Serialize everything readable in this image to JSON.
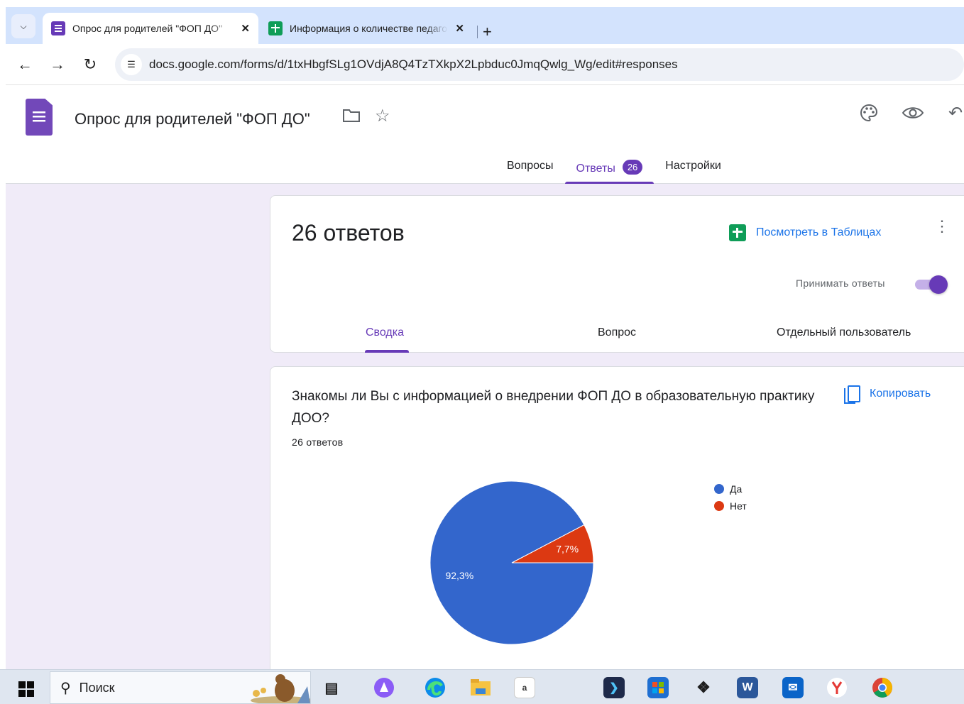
{
  "browser": {
    "tabs": [
      {
        "title": "Опрос для родителей \"ФОП ДО\"",
        "favicon": "forms-icon",
        "active": true
      },
      {
        "title": "Информация о количестве педагогов",
        "favicon": "sheets-icon",
        "active": false
      }
    ],
    "close_glyph": "✕",
    "new_tab_glyph": "+",
    "url": "docs.google.com/forms/d/1txHbgfSLg1OVdjA8Q4TzTXkpX2Lpbduc0JmqQwlg_Wg/edit#responses"
  },
  "form": {
    "title": "Опрос для родителей \"ФОП ДО\"",
    "tabs": [
      {
        "label": "Вопросы"
      },
      {
        "label": "Ответы",
        "badge": "26"
      },
      {
        "label": "Настройки"
      }
    ]
  },
  "summary": {
    "count_label": "26 ответов",
    "sheets_link": "Посмотреть в Таблицах",
    "accept_label": "Принимать ответы",
    "accepting": true,
    "sub_tabs": [
      "Сводка",
      "Вопрос",
      "Отдельный пользователь"
    ]
  },
  "question": {
    "text": "Знакомы ли Вы с информацией о внедрении ФОП ДО в образовательную практику ДОО?",
    "count": "26 ответов",
    "copy_label": "Копировать"
  },
  "chart_data": {
    "type": "pie",
    "categories": [
      "Да",
      "Нет"
    ],
    "values": [
      92.3,
      7.7
    ],
    "data_labels": [
      "92,3%",
      "7,7%"
    ],
    "colors": [
      "#3366cc",
      "#dc3912"
    ],
    "legend_position": "right"
  },
  "taskbar": {
    "search_placeholder": "Поиск",
    "icons": [
      "task-view-icon",
      "alice-icon",
      "edge-icon",
      "file-explorer-icon",
      "app-a-icon",
      "terminal-icon",
      "store-icon",
      "dropbox-icon",
      "word-icon",
      "mail-icon",
      "yandex-icon",
      "chrome-icon"
    ]
  }
}
